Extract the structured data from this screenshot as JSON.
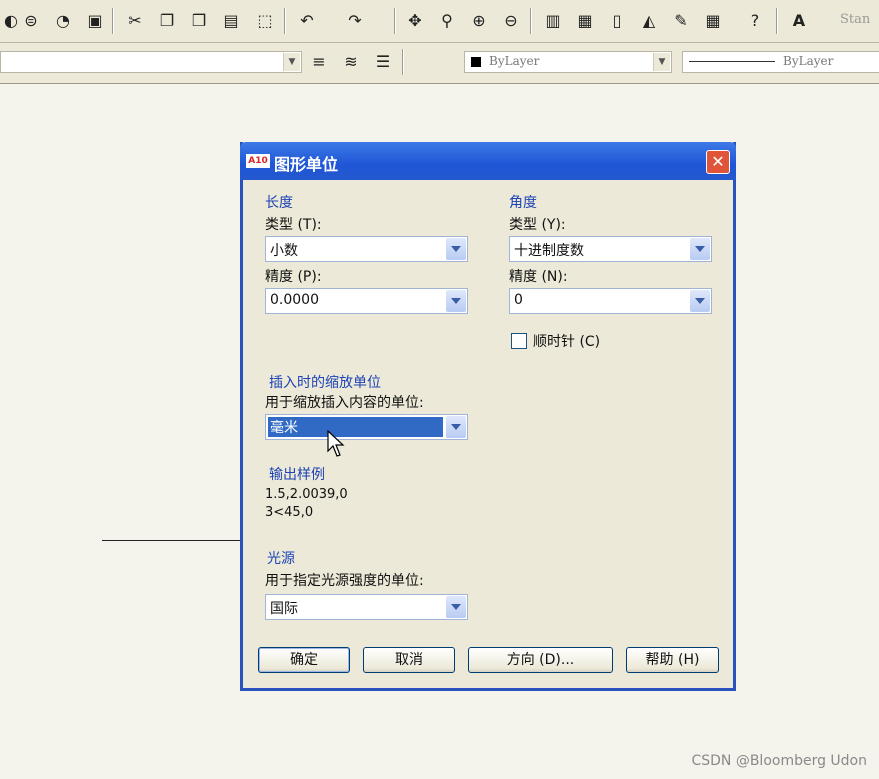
{
  "toolbar": {
    "layer_combo": "ByLayer",
    "linetype_combo": "ByLayer",
    "text_style": "Stan"
  },
  "dialog": {
    "title": "图形单位",
    "icon_text": "A10",
    "close": "✕",
    "length": {
      "group": "长度",
      "type_label": "类型 (T):",
      "type_value": "小数",
      "precision_label": "精度 (P):",
      "precision_value": "0.0000"
    },
    "angle": {
      "group": "角度",
      "type_label": "类型 (Y):",
      "type_value": "十进制度数",
      "precision_label": "精度 (N):",
      "precision_value": "0",
      "clockwise_label": "顺时针 (C)",
      "clockwise_checked": false
    },
    "insertion": {
      "group": "插入时的缩放单位",
      "label": "用于缩放插入内容的单位:",
      "value": "毫米"
    },
    "sample": {
      "group": "输出样例",
      "line1": "1.5,2.0039,0",
      "line2": "3<45,0"
    },
    "lighting": {
      "group": "光源",
      "label": "用于指定光源强度的单位:",
      "value": "国际"
    },
    "buttons": {
      "ok": "确定",
      "cancel": "取消",
      "direction": "方向 (D)...",
      "help": "帮助 (H)"
    }
  },
  "watermark": "CSDN @Bloomberg Udon"
}
